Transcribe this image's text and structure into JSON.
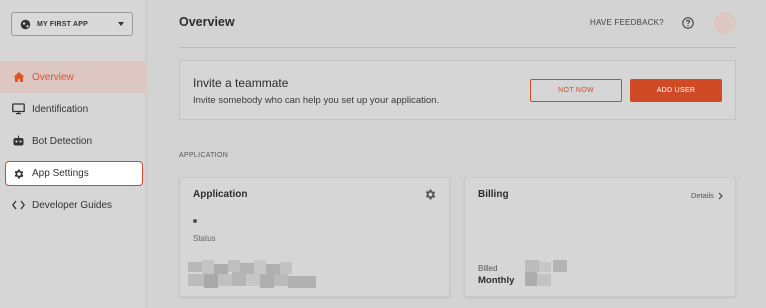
{
  "app_selector": {
    "name": "MY FIRST APP",
    "icon": "globe-icon"
  },
  "sidebar": {
    "items": [
      {
        "label": "Overview",
        "icon": "home-icon",
        "state": "active"
      },
      {
        "label": "Identification",
        "icon": "monitor-icon",
        "state": "normal"
      },
      {
        "label": "Bot Detection",
        "icon": "robot-icon",
        "state": "normal"
      },
      {
        "label": "App Settings",
        "icon": "gear-icon",
        "state": "highlighted"
      },
      {
        "label": "Developer Guides",
        "icon": "code-icon",
        "state": "normal"
      }
    ]
  },
  "header": {
    "title": "Overview",
    "feedback_label": "HAVE FEEDBACK?"
  },
  "invite": {
    "title": "Invite a teammate",
    "subtitle": "Invite somebody who can help you set up your application.",
    "not_now_label": "NOT NOW",
    "add_user_label": "ADD USER"
  },
  "section": {
    "label": "APPLICATION"
  },
  "application_card": {
    "title": "Application",
    "status_label": "Status"
  },
  "billing_card": {
    "title": "Billing",
    "details_label": "Details",
    "billed_label": "Billed",
    "billed_value": "Monthly"
  },
  "colors": {
    "accent": "#d14a26",
    "active_nav_bg": "#dcc7c2",
    "background": "#d3d3d3"
  }
}
